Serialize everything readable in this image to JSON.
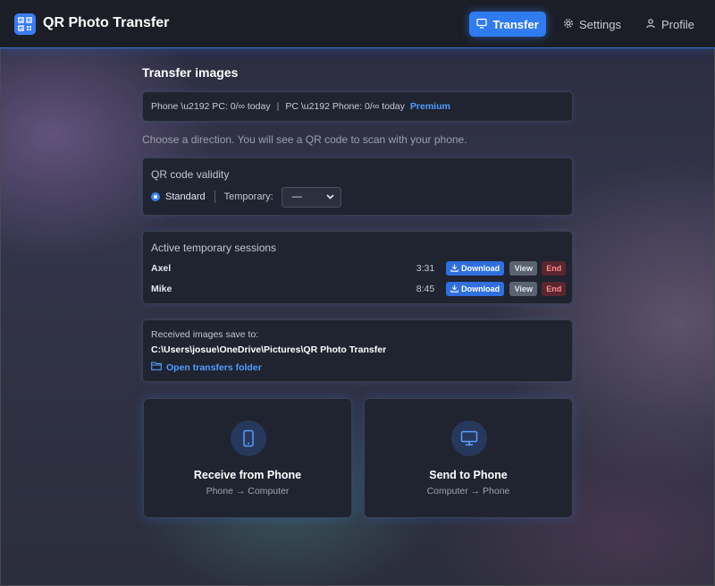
{
  "app": {
    "title": "QR Photo Transfer"
  },
  "nav": {
    "transfer": "Transfer",
    "settings": "Settings",
    "profile": "Profile"
  },
  "main": {
    "title": "Transfer images",
    "quota": {
      "phone_to_pc": "Phone \\u2192 PC: 0/∞ today",
      "separator": "|",
      "pc_to_phone": "PC \\u2192 Phone: 0/∞ today",
      "premium": "Premium"
    },
    "hint": "Choose a direction. You will see a QR code to scan with your phone.",
    "validity": {
      "title": "QR code validity",
      "standard_label": "Standard",
      "temporary_label": "Temporary:",
      "temporary_value": "—"
    },
    "sessions": {
      "title": "Active temporary sessions",
      "download_label": "Download",
      "view_label": "View",
      "end_label": "End",
      "rows": [
        {
          "name": "Axel",
          "time": "3:31"
        },
        {
          "name": "Mike",
          "time": "8:45"
        }
      ]
    },
    "save": {
      "label": "Received images save to:",
      "path": "C:\\Users\\josue\\OneDrive\\Pictures\\QR Photo Transfer",
      "open_label": "Open transfers folder"
    },
    "cards": {
      "receive": {
        "title": "Receive from Phone",
        "subtitle": "Phone → Computer"
      },
      "send": {
        "title": "Send to Phone",
        "subtitle": "Computer → Phone"
      }
    }
  },
  "colors": {
    "accent": "#2f7bf0",
    "link": "#4f9cff",
    "danger": "#ff8a8a"
  }
}
